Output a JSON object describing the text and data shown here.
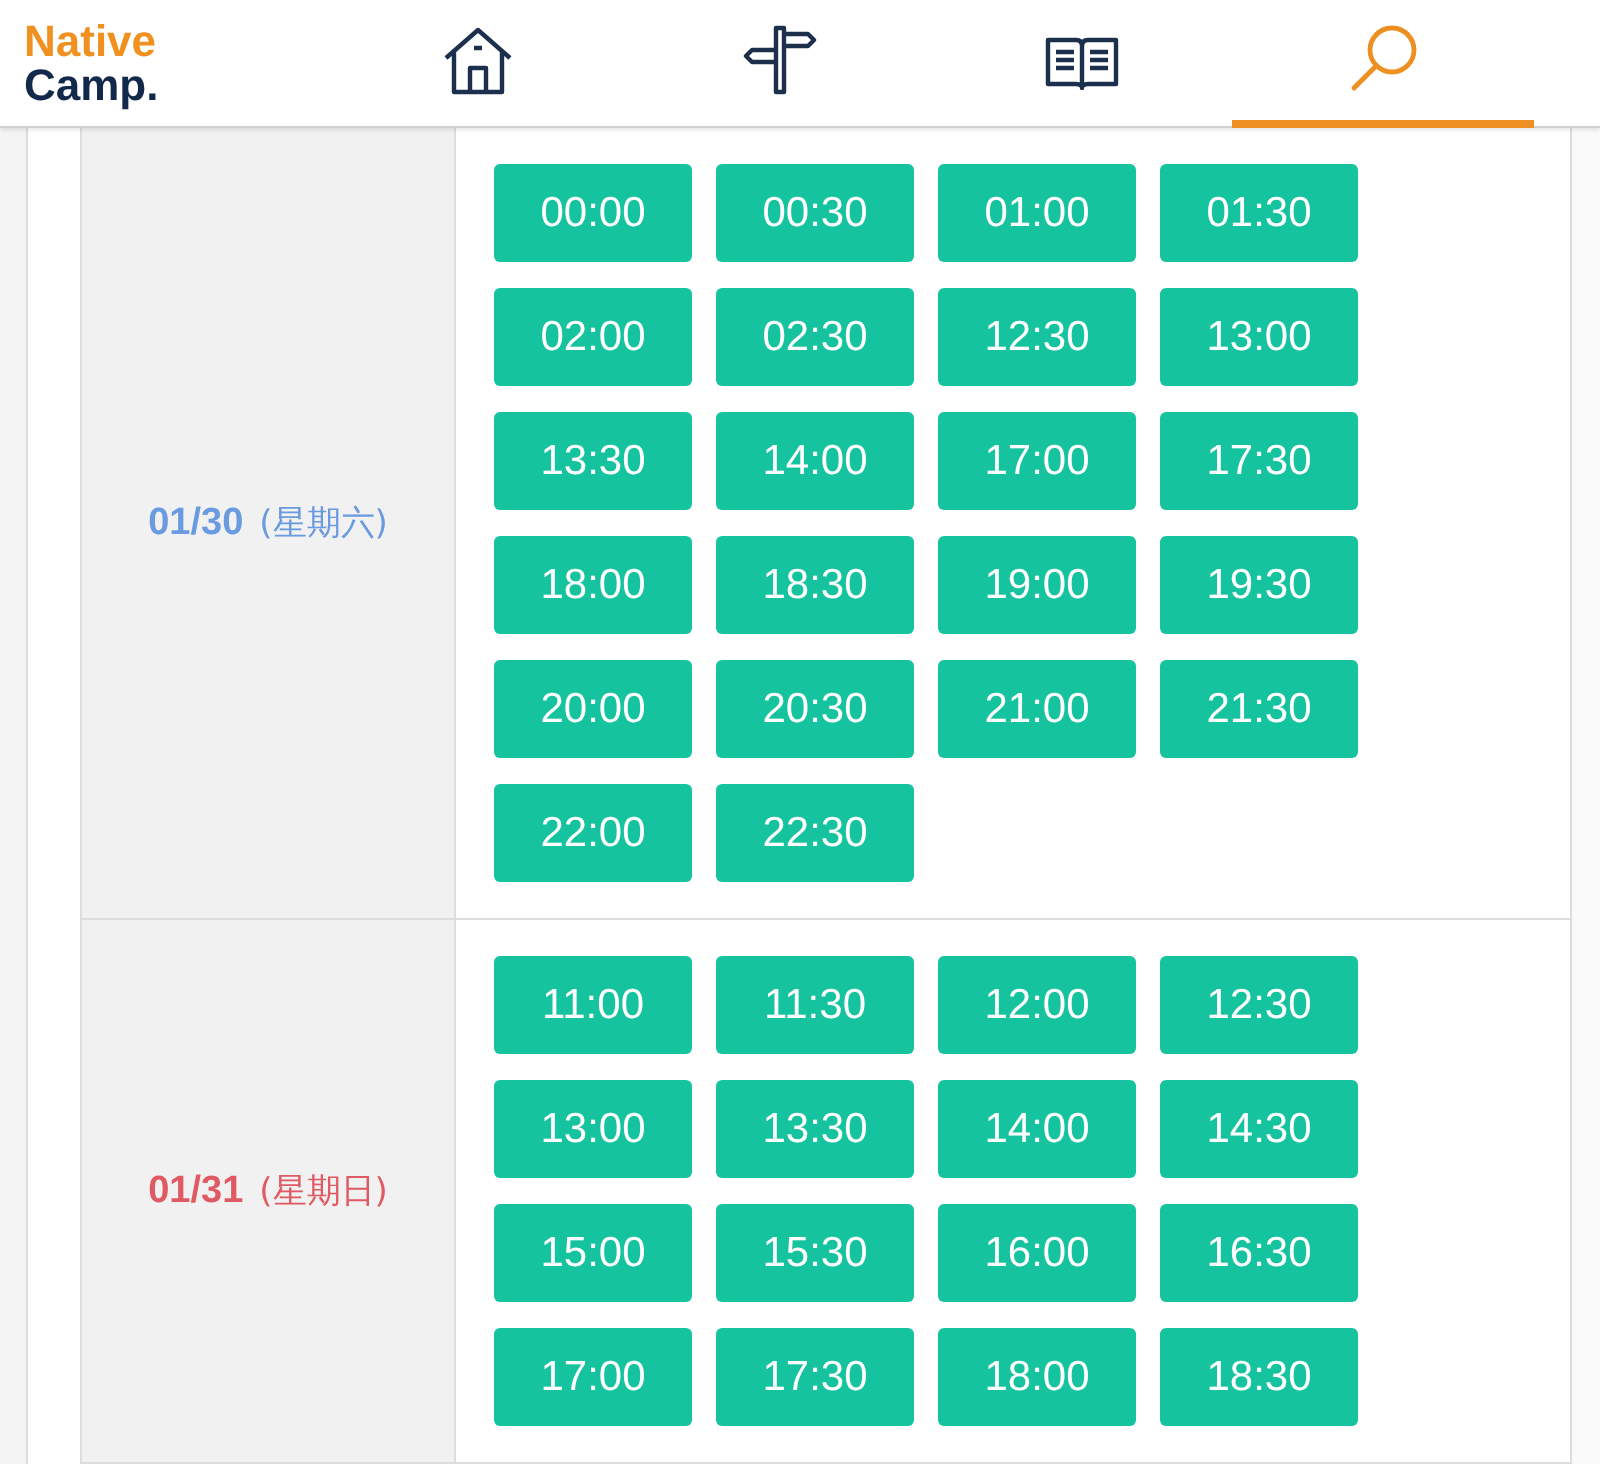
{
  "logo": {
    "line1": "Native",
    "line2": "Camp."
  },
  "nav": [
    {
      "kind": "home",
      "selected": false
    },
    {
      "kind": "signpost",
      "selected": false
    },
    {
      "kind": "book",
      "selected": false
    },
    {
      "kind": "search",
      "selected": true
    }
  ],
  "days": [
    {
      "date": "01/30",
      "weekday": "(星期六)",
      "color": "#6a9be0",
      "slots": [
        "00:00",
        "00:30",
        "01:00",
        "01:30",
        "02:00",
        "02:30",
        "12:30",
        "13:00",
        "13:30",
        "14:00",
        "17:00",
        "17:30",
        "18:00",
        "18:30",
        "19:00",
        "19:30",
        "20:00",
        "20:30",
        "21:00",
        "21:30",
        "22:00",
        "22:30"
      ]
    },
    {
      "date": "01/31",
      "weekday": "(星期日)",
      "color": "#e05a63",
      "slots": [
        "11:00",
        "11:30",
        "12:00",
        "12:30",
        "13:00",
        "13:30",
        "14:00",
        "14:30",
        "15:00",
        "15:30",
        "16:00",
        "16:30",
        "17:00",
        "17:30",
        "18:00",
        "18:30"
      ]
    }
  ]
}
